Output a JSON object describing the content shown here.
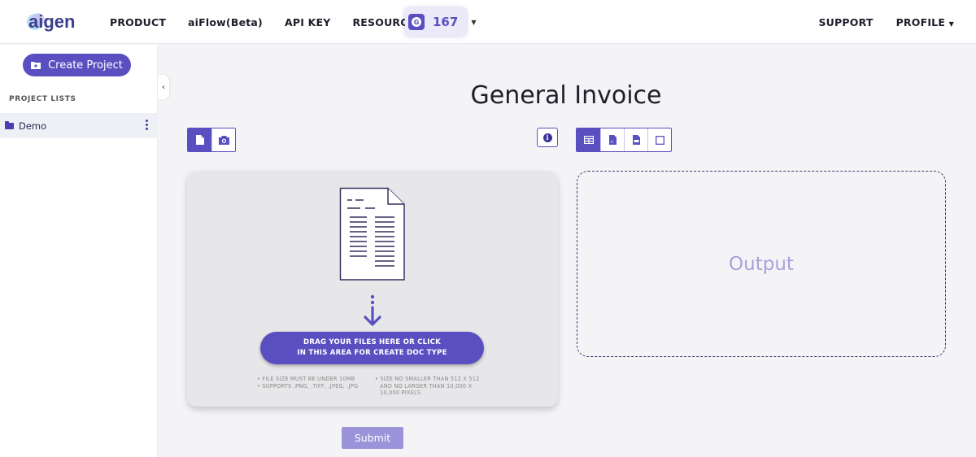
{
  "header": {
    "logo_text": "aigen",
    "nav": [
      "PRODUCT",
      "aiFlow(Beta)",
      "API KEY",
      "RESOURCES"
    ],
    "credits": {
      "count": "167"
    },
    "right_nav": {
      "support": "SUPPORT",
      "profile": "PROFILE"
    }
  },
  "sidebar": {
    "create_label": "Create Project",
    "section_label": "PROJECT LISTS",
    "projects": [
      {
        "name": "Demo"
      }
    ]
  },
  "main": {
    "title": "General Invoice",
    "input_modes": [
      "file-icon",
      "camera-icon"
    ],
    "output_modes": [
      "table-icon",
      "json-file-icon",
      "csv-file-icon",
      "square-icon"
    ],
    "upload": {
      "drag_line1": "DRAG YOUR FILES HERE OR CLICK",
      "drag_line2": "IN THIS AREA FOR CREATE DOC TYPE",
      "note_left_1": "• FILE SIZE MUST BE UNDER 10MB",
      "note_left_2": "• SUPPORTS .PNG, .TIFF, .JPEG, .JPG",
      "note_right_1": "• SIZE NO SMALLER THAN 512 X 512",
      "note_right_2": "AND NO LARGER THAN 10,000 X",
      "note_right_3": "10,000 PIXELS"
    },
    "submit_label": "Submit",
    "output_label": "Output"
  },
  "colors": {
    "accent": "#5a4fc0",
    "submit": "#9b94da",
    "output_text": "#a8a2dc"
  }
}
